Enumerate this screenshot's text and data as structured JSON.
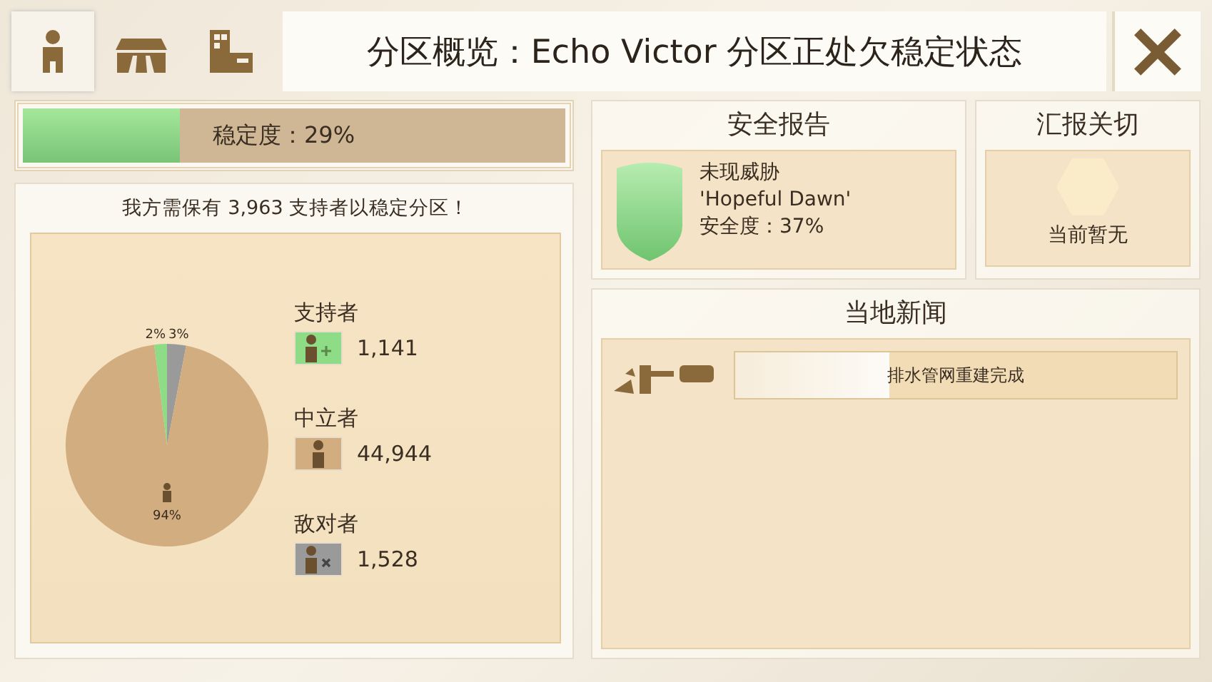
{
  "header": {
    "title": "分区概览：Echo Victor 分区正处欠稳定状态",
    "close": "×",
    "tabs": [
      {
        "kind": "person",
        "selected": true
      },
      {
        "kind": "road",
        "selected": false
      },
      {
        "kind": "building",
        "selected": false
      }
    ]
  },
  "stability": {
    "label": "稳定度：29%",
    "level": 0.29
  },
  "population": {
    "message": "我方需保有 3,963 支持者以稳定分区！",
    "groups": [
      {
        "kind": "supporter",
        "label": "支持者",
        "count": "1,141",
        "color": "#8fdc86"
      },
      {
        "kind": "neutral",
        "label": "中立者",
        "count": "44,944",
        "color": "#d2ad80"
      },
      {
        "kind": "hostile",
        "label": "敌对者",
        "count": "1,528",
        "color": "#9a9a9a"
      }
    ],
    "chart_data": {
      "type": "pie",
      "values": [
        2,
        94,
        3
      ],
      "value_labels": [
        "2%",
        "94%",
        "3%"
      ]
    }
  },
  "security": {
    "title": "安全报告",
    "threat": "未现威胁",
    "name": "'Hopeful Dawn'",
    "rating": "安全度：37%"
  },
  "report": {
    "title": "汇报关切",
    "status": "当前暂无"
  },
  "news": {
    "title": "当地新闻",
    "items": [
      {
        "text": "排水管网重建完成",
        "level": 0.35
      }
    ]
  }
}
